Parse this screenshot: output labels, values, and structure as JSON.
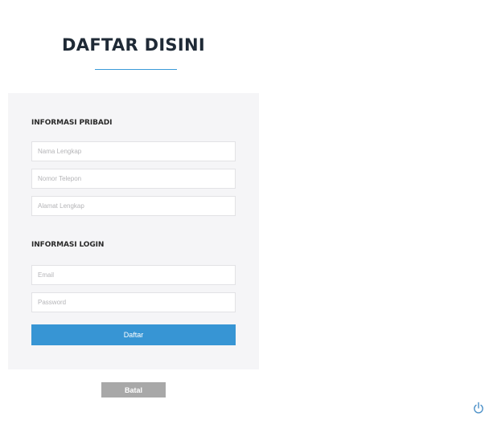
{
  "header": {
    "title": "DAFTAR DISINI"
  },
  "personal_section": {
    "title": "INFORMASI PRIBADI",
    "fields": {
      "full_name": {
        "value": "",
        "placeholder": "Nama Lengkap"
      },
      "phone": {
        "value": "",
        "placeholder": "Nomor Telepon"
      },
      "address": {
        "value": "",
        "placeholder": "Alamat Lengkap"
      }
    }
  },
  "login_section": {
    "title": "INFORMASI LOGIN",
    "fields": {
      "email": {
        "value": "",
        "placeholder": "Email"
      },
      "password": {
        "value": "",
        "placeholder": "Password"
      }
    }
  },
  "actions": {
    "submit_label": "Daftar",
    "cancel_label": "Batal"
  },
  "colors": {
    "accent": "#3795d4",
    "panel_background": "#f5f5f7",
    "cancel_button": "#a8a8a8",
    "title_text": "#1f2a36"
  },
  "icons": {
    "corner_icon": "power-icon"
  }
}
